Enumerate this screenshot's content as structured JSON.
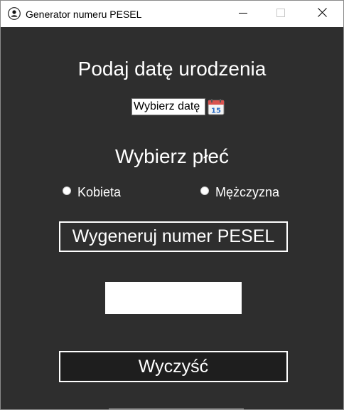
{
  "window": {
    "title": "Generator numeru PESEL",
    "icons": {
      "app": "user-avatar-icon",
      "minimize": "minimize-icon",
      "maximize": "maximize-icon",
      "close": "close-icon"
    }
  },
  "form": {
    "date_heading": "Podaj datę urodzenia",
    "date_input_value": "Wybierz datę",
    "calendar_icon": "calendar-icon",
    "calendar_icon_text": "15",
    "sex_heading": "Wybierz płeć",
    "sex_options": [
      {
        "label": "Kobieta",
        "selected": false
      },
      {
        "label": "Mężczyzna",
        "selected": false
      }
    ],
    "generate_button": "Wygeneruj numer PESEL",
    "result_value": "",
    "clear_button": "Wyczyść"
  },
  "colors": {
    "background": "#2e2e2e",
    "text": "#ffffff",
    "clear_button_bg": "#1e1e1e",
    "calendar_blue": "#2a6cc4"
  }
}
